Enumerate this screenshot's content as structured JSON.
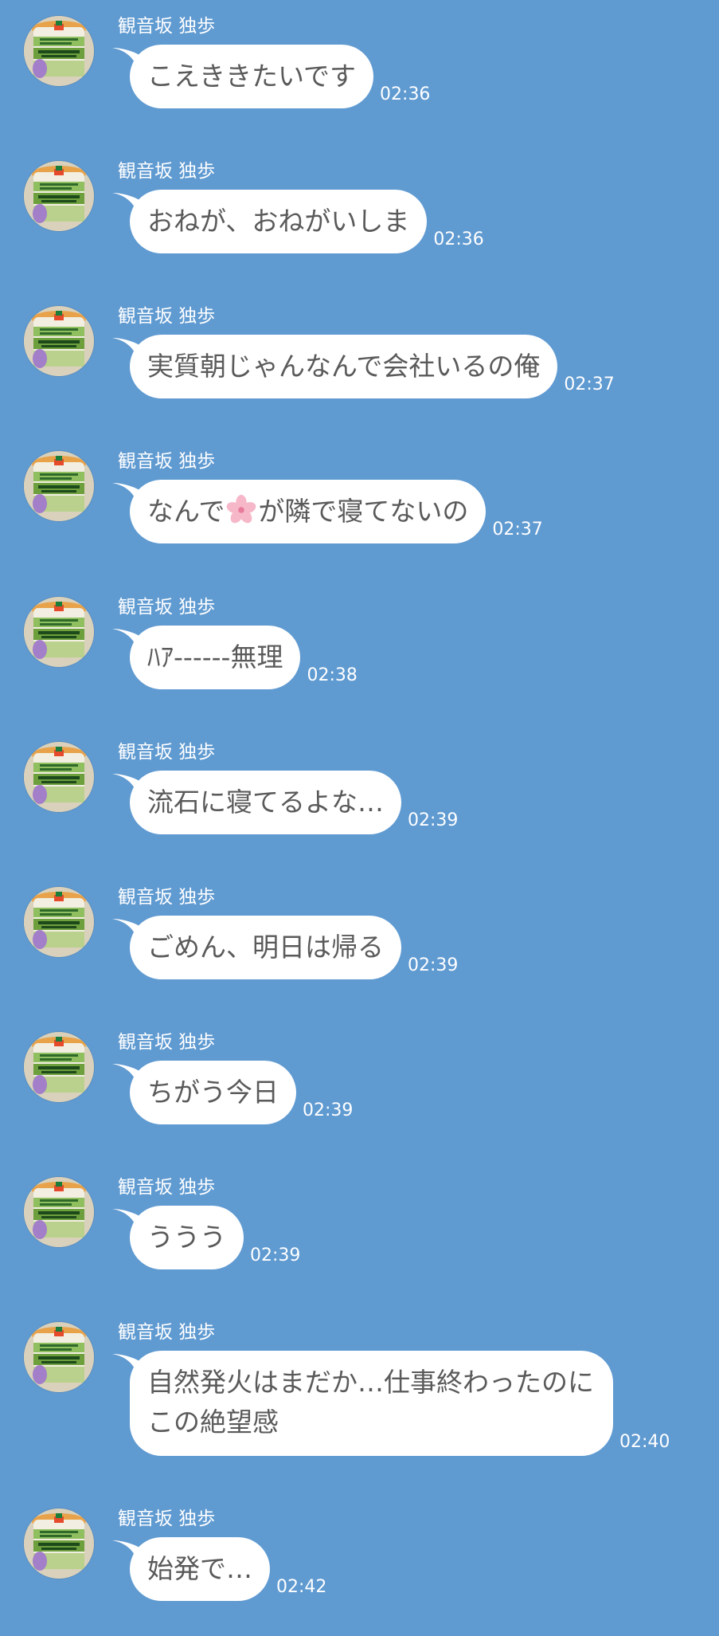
{
  "chat": {
    "messages": [
      {
        "sender": "観音坂 独歩",
        "lines": [
          "こえききたいです"
        ],
        "time": "02:36"
      },
      {
        "sender": "観音坂 独歩",
        "lines": [
          "おねが、おねがいしま"
        ],
        "time": "02:36"
      },
      {
        "sender": "観音坂 独歩",
        "lines": [
          "実質朝じゃんなんで会社いるの俺"
        ],
        "time": "02:37"
      },
      {
        "sender": "観音坂 独歩",
        "lines": [
          "なんで",
          "が隣で寝てないの"
        ],
        "emoji": "cherry-blossom-icon",
        "time": "02:37"
      },
      {
        "sender": "観音坂 独歩",
        "lines": [
          "ﾊｱ------無理"
        ],
        "time": "02:38"
      },
      {
        "sender": "観音坂 独歩",
        "lines": [
          "流石に寝てるよな…"
        ],
        "time": "02:39"
      },
      {
        "sender": "観音坂 独歩",
        "lines": [
          "ごめん、明日は帰る"
        ],
        "time": "02:39"
      },
      {
        "sender": "観音坂 独歩",
        "lines": [
          "ちがう今日"
        ],
        "time": "02:39"
      },
      {
        "sender": "観音坂 独歩",
        "lines": [
          "ううう"
        ],
        "time": "02:39"
      },
      {
        "sender": "観音坂 独歩",
        "lines": [
          "自然発火はまだか…仕事終わったのに",
          "この絶望感"
        ],
        "time": "02:40"
      },
      {
        "sender": "観音坂 独歩",
        "lines": [
          "始発で…"
        ],
        "time": "02:42"
      }
    ]
  },
  "colors": {
    "background": "#5f9ad1",
    "bubble": "#ffffff",
    "message_text": "#5a5a5a",
    "meta_text": "#ffffff",
    "sakura_petal": "#f6b7c9"
  }
}
